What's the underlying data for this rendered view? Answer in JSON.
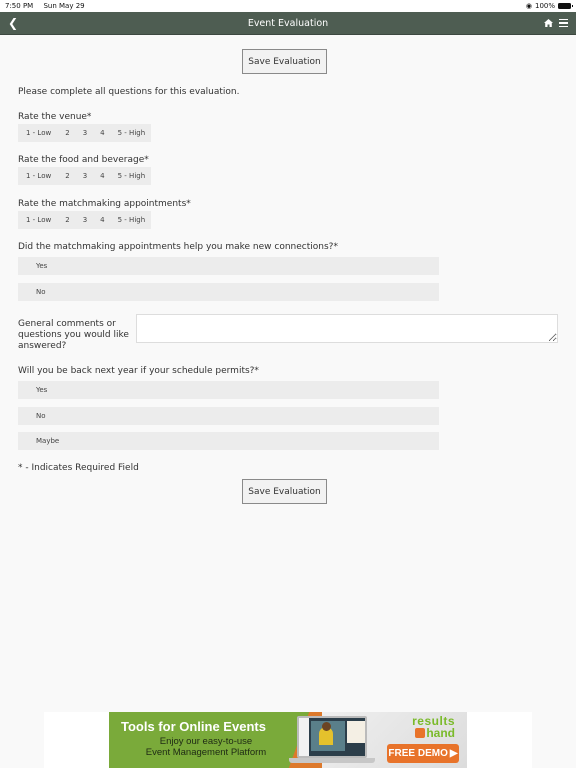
{
  "status_bar": {
    "time": "7:50 PM",
    "date": "Sun May 29",
    "battery": "100%"
  },
  "nav": {
    "title": "Event Evaluation",
    "back_icon": "chevron-left-icon",
    "home_icon": "home-icon",
    "menu_icon": "hamburger-menu-icon"
  },
  "form": {
    "save_label": "Save Evaluation",
    "intro": "Please complete all questions for this evaluation.",
    "rating_options": [
      "1 - Low",
      "2",
      "3",
      "4",
      "5 - High"
    ],
    "questions": {
      "venue": "Rate the venue*",
      "food": "Rate the food and beverage*",
      "matchmaking": "Rate the matchmaking appointments*",
      "connections": "Did the matchmaking appointments help you make new connections?*",
      "comments": "General comments or questions you would like answered?",
      "back_next_year": "Will you be back next year if your schedule permits?*"
    },
    "connections_options": [
      "Yes",
      "No"
    ],
    "back_next_year_options": [
      "Yes",
      "No",
      "Maybe"
    ],
    "comments_value": "",
    "required_note": "* - Indicates Required Field"
  },
  "ad": {
    "title": "Tools for Online Events",
    "subtitle_line1": "Enjoy our easy-to-use",
    "subtitle_line2": "Event Management Platform",
    "logo_top": "results",
    "logo_bottom": "hand",
    "cta": "FREE DEMO",
    "colors": {
      "green": "#7aaa3a",
      "orange": "#e8732a"
    }
  }
}
